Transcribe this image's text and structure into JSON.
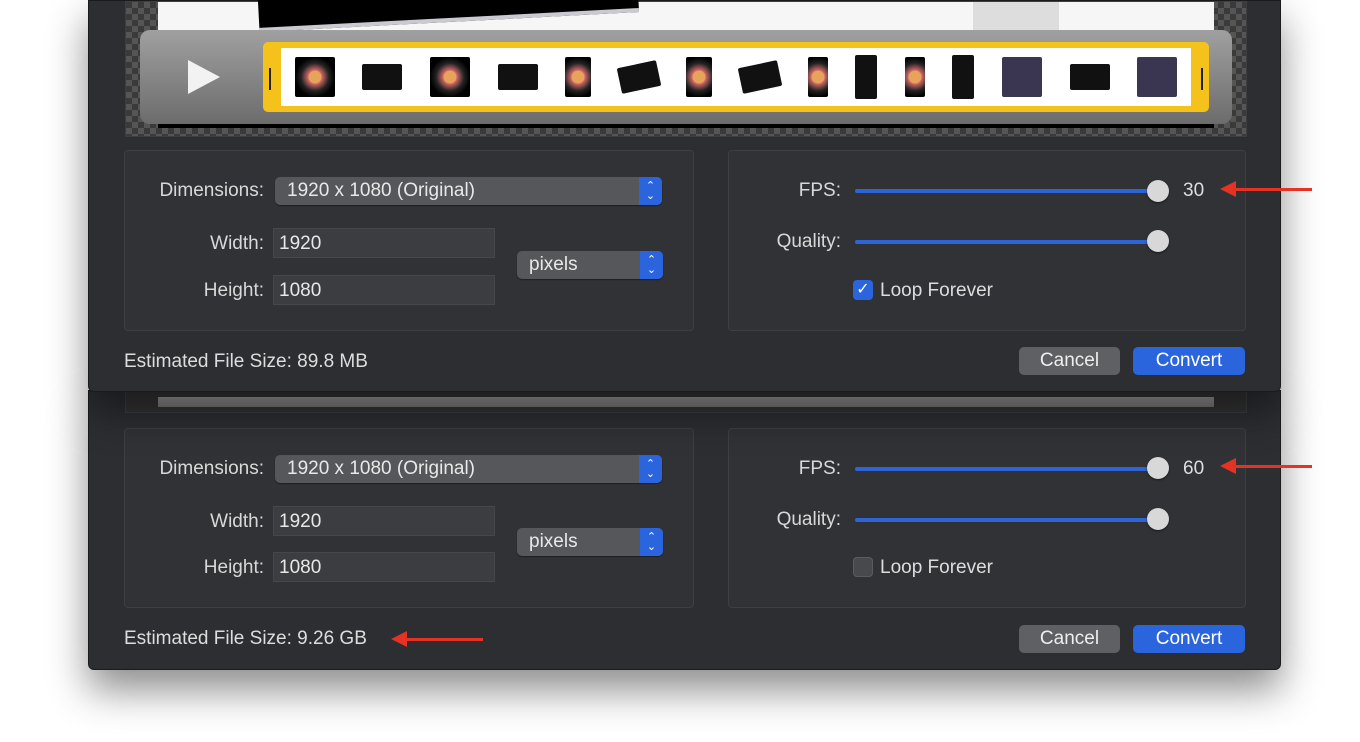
{
  "dialogs": [
    {
      "dimensions_label": "Dimensions:",
      "dimensions_value": "1920 x 1080 (Original)",
      "width_label": "Width:",
      "width_value": "1920",
      "height_label": "Height:",
      "height_value": "1080",
      "units": "pixels",
      "fps_label": "FPS:",
      "fps_value": "30",
      "fps_fraction": 1.0,
      "quality_label": "Quality:",
      "quality_fraction": 1.0,
      "loop_label": "Loop Forever",
      "loop_checked": true,
      "file_size": "Estimated File Size: 89.8 MB",
      "cancel": "Cancel",
      "convert": "Convert"
    },
    {
      "dimensions_label": "Dimensions:",
      "dimensions_value": "1920 x 1080 (Original)",
      "width_label": "Width:",
      "width_value": "1920",
      "height_label": "Height:",
      "height_value": "1080",
      "units": "pixels",
      "fps_label": "FPS:",
      "fps_value": "60",
      "fps_fraction": 1.0,
      "quality_label": "Quality:",
      "quality_fraction": 1.0,
      "loop_label": "Loop Forever",
      "loop_checked": false,
      "file_size": "Estimated File Size: 9.26 GB",
      "cancel": "Cancel",
      "convert": "Convert"
    }
  ],
  "colors": {
    "accent": "#2b65de",
    "trim_border": "#f5c21b",
    "annotation_arrow": "#e53222"
  },
  "icons": {
    "play": "play-icon",
    "stepper": "up-down-chevron-icon",
    "checkmark": "checkmark-icon"
  }
}
